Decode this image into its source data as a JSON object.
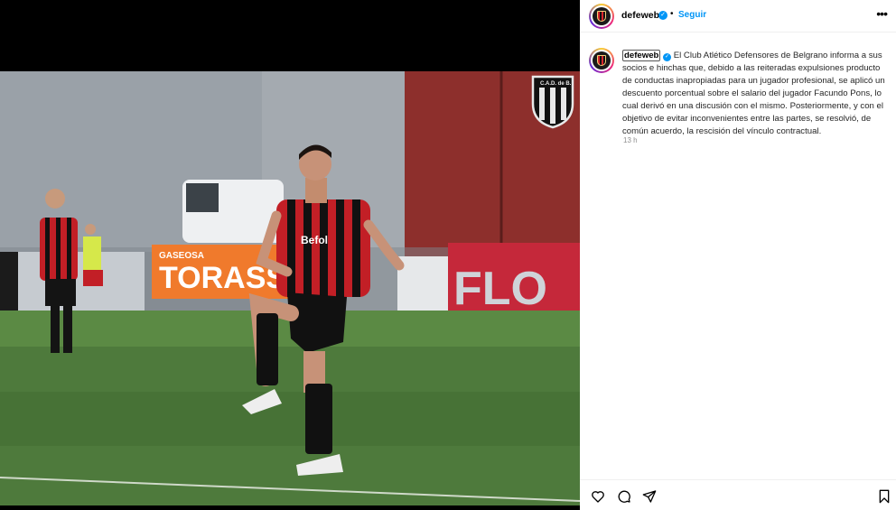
{
  "post": {
    "username": "defeweb",
    "dot": "•",
    "follow_label": "Seguir",
    "more_label": "•••",
    "caption_text": "El Club Atlético Defensores de Belgrano informa a sus socios e hinchas que, debido a las reiteradas expulsiones producto de conductas inapropiadas para un jugador profesional, se aplicó un descuento porcentual sobre el salario del jugador Facundo Pons, lo cual derivó en una discusión con el mismo. Posteriormente, y con el objetivo de evitar inconvenientes entre las partes, se resolvió, de común acuerdo, la rescisión del vínculo contractual.",
    "timestamp": "13 h",
    "verified_glyph": "✓"
  },
  "photo": {
    "banner_sign": "GASEOSA",
    "banner_brand": "TORASSO",
    "banner_red": "FLO",
    "shirt_sponsor": "Befol",
    "crest_text": "C.A.D. de B."
  },
  "icons": [
    "heart-icon",
    "comment-icon",
    "share-icon",
    "bookmark-icon",
    "more-icon",
    "verified-icon"
  ],
  "colors": {
    "accent": "#0095f6",
    "team_red": "#d8262c",
    "team_black": "#111111"
  }
}
